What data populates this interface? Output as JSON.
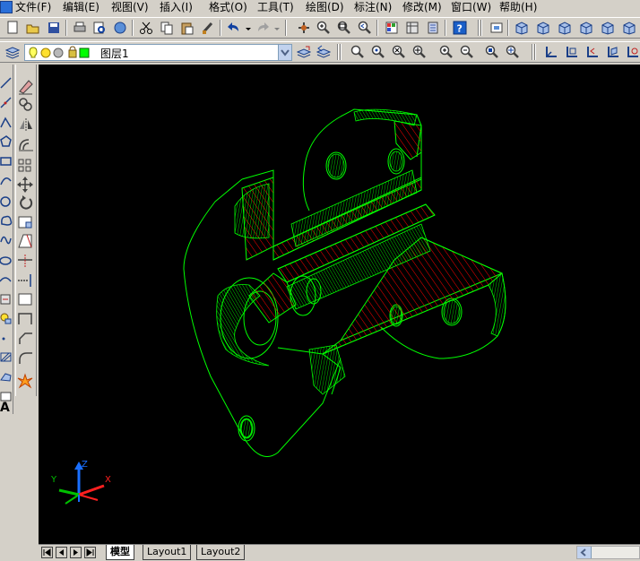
{
  "menu": {
    "items": [
      {
        "label": "文件(F)"
      },
      {
        "label": "编辑(E)"
      },
      {
        "label": "视图(V)"
      },
      {
        "label": "插入(I)"
      },
      {
        "label": "格式(O)"
      },
      {
        "label": "工具(T)"
      },
      {
        "label": "绘图(D)"
      },
      {
        "label": "标注(N)"
      },
      {
        "label": "修改(M)"
      },
      {
        "label": "窗口(W)"
      },
      {
        "label": "帮助(H)"
      }
    ]
  },
  "layer": {
    "current": "图层1"
  },
  "ucs": {
    "x": "X",
    "y": "Y",
    "z": "Z"
  },
  "tabs": [
    {
      "label": "模型",
      "active": true
    },
    {
      "label": "Layout1",
      "active": false
    },
    {
      "label": "Layout2",
      "active": false
    }
  ],
  "colors": {
    "canvas": "#000000",
    "drawing": "#00ff00",
    "hatch": "#ff0000"
  }
}
